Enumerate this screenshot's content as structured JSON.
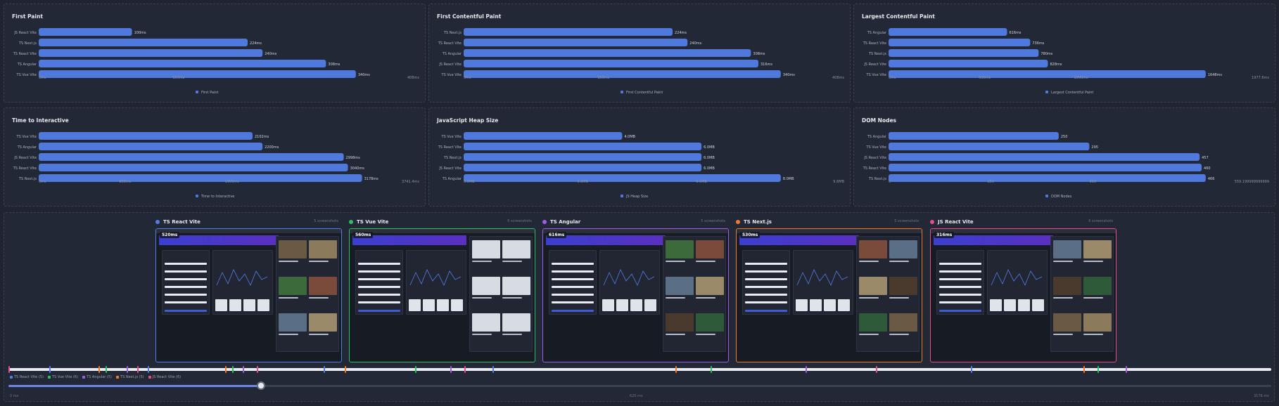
{
  "chart_data": [
    {
      "type": "bar",
      "orientation": "horizontal",
      "title": "First Paint",
      "unit": "ms",
      "categories": [
        "JS React Vite",
        "TS Next.js",
        "TS React Vite",
        "TS Angular",
        "TS Vue Vite"
      ],
      "values": [
        100,
        224,
        240,
        308,
        340
      ],
      "value_labels": [
        "100ms",
        "224ms",
        "240ms",
        "308ms",
        "340ms"
      ],
      "xlim": [
        0,
        408
      ],
      "xticks": [
        "0ms",
        "150ms",
        "408ms"
      ],
      "xtick_values": [
        0,
        150,
        408
      ],
      "legend": "First Paint",
      "color": "#4f79dc"
    },
    {
      "type": "bar",
      "orientation": "horizontal",
      "title": "First Contentful Paint",
      "unit": "ms",
      "categories": [
        "TS Next.js",
        "TS React Vite",
        "TS Angular",
        "JS React Vite",
        "TS Vue Vite"
      ],
      "values": [
        224,
        240,
        308,
        316,
        340
      ],
      "value_labels": [
        "224ms",
        "240ms",
        "308ms",
        "316ms",
        "340ms"
      ],
      "xlim": [
        0,
        408
      ],
      "xticks": [
        "0ms",
        "150ms",
        "408ms"
      ],
      "xtick_values": [
        0,
        150,
        408
      ],
      "legend": "First Contentful Paint",
      "color": "#4f79dc"
    },
    {
      "type": "bar",
      "orientation": "horizontal",
      "title": "Largest Contentful Paint",
      "unit": "ms",
      "categories": [
        "TS Angular",
        "TS React Vite",
        "TS Next.js",
        "JS React Vite",
        "TS Vue Vite"
      ],
      "values": [
        616,
        736,
        780,
        828,
        1648
      ],
      "value_labels": [
        "616ms",
        "736ms",
        "780ms",
        "828ms",
        "1648ms"
      ],
      "xlim": [
        0,
        1977.6
      ],
      "xticks": [
        "0ms",
        "500ms",
        "1000ms",
        "1977.6ms"
      ],
      "xtick_values": [
        0,
        500,
        1000,
        1977.6
      ],
      "legend": "Largest Contentful Paint",
      "color": "#4f79dc"
    },
    {
      "type": "bar",
      "orientation": "horizontal",
      "title": "Time to Interactive",
      "unit": "ms",
      "categories": [
        "TS Vue Vite",
        "TS Angular",
        "JS React Vite",
        "TS React Vite",
        "TS Next.js"
      ],
      "values": [
        2102,
        2200,
        2998,
        3040,
        3178
      ],
      "value_labels": [
        "2102ms",
        "2200ms",
        "2998ms",
        "3040ms",
        "3178ms"
      ],
      "xlim": [
        0,
        3741
      ],
      "xticks": [
        "0ms",
        "850ms",
        "1900ms",
        "3741.4ms"
      ],
      "xtick_values": [
        0,
        850,
        1900,
        3741
      ],
      "legend": "Time to Interactive",
      "color": "#4f79dc"
    },
    {
      "type": "bar",
      "orientation": "horizontal",
      "title": "JavaScript Heap Size",
      "unit": "MB",
      "categories": [
        "TS Vue Vite",
        "TS React Vite",
        "TS Next.js",
        "JS React Vite",
        "TS Angular"
      ],
      "values": [
        4.0,
        6.0,
        6.0,
        6.0,
        8.0
      ],
      "value_labels": [
        "4.0MB",
        "6.0MB",
        "6.0MB",
        "6.0MB",
        "8.0MB"
      ],
      "xlim": [
        0,
        9.6
      ],
      "xticks": [
        "0.0MB",
        "3.0MB",
        "6.0MB",
        "9.6MB"
      ],
      "xtick_values": [
        0,
        3,
        6,
        9.6
      ],
      "legend": "JS Heap Size",
      "color": "#4f79dc"
    },
    {
      "type": "bar",
      "orientation": "horizontal",
      "title": "DOM Nodes",
      "unit": "",
      "categories": [
        "TS Angular",
        "TS Vue Vite",
        "JS React Vite",
        "TS React Vite",
        "TS Next.js"
      ],
      "values": [
        250,
        295,
        457,
        460,
        466
      ],
      "value_labels": [
        "250",
        "295",
        "457",
        "460",
        "466"
      ],
      "xlim": [
        0,
        559.2
      ],
      "xticks": [
        "0",
        "150",
        "300",
        "559.199999999999"
      ],
      "xtick_values": [
        0,
        150,
        300,
        559.2
      ],
      "legend": "DOM Nodes",
      "color": "#4f79dc"
    }
  ],
  "gallery": {
    "items": [
      {
        "name": "TS React Vite",
        "color": "#4f7ee6",
        "count": "5 screenshots",
        "timing": "520ms"
      },
      {
        "name": "TS Vue Vite",
        "color": "#2fbf5f",
        "count": "6 screenshots",
        "timing": "560ms"
      },
      {
        "name": "TS Angular",
        "color": "#a05ce8",
        "count": "5 screenshots",
        "timing": "616ms"
      },
      {
        "name": "TS Next.js",
        "color": "#f07a2c",
        "count": "5 screenshots",
        "timing": "530ms"
      },
      {
        "name": "JS React Vite",
        "color": "#e84d8a",
        "count": "6 screenshots",
        "timing": "316ms"
      }
    ]
  },
  "timeline": {
    "legend": [
      {
        "label": "TS React Vite (5)",
        "color": "#4f7ee6"
      },
      {
        "label": "TS Vue Vite (6)",
        "color": "#2fbf5f"
      },
      {
        "label": "TS Angular (5)",
        "color": "#a05ce8"
      },
      {
        "label": "TS Next.js (5)",
        "color": "#f07a2c"
      },
      {
        "label": "JS React Vite (6)",
        "color": "#e84d8a"
      }
    ],
    "start_label": "0 ms",
    "mid_label": "620 ms",
    "end_label": "3178 ms",
    "position_fraction": 0.2
  }
}
